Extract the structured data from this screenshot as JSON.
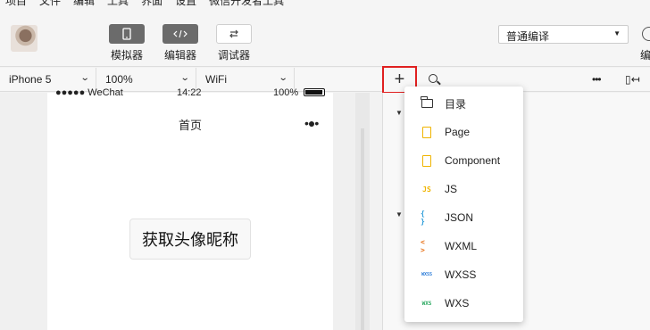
{
  "menubar": {
    "items": [
      "项目",
      "文件",
      "编辑",
      "工具",
      "界面",
      "设置",
      "微信开发者工具"
    ]
  },
  "toolbar": {
    "tools": [
      {
        "label": "模拟器",
        "icon": "phone-icon"
      },
      {
        "label": "编辑器",
        "icon": "code-icon"
      },
      {
        "label": "调试器",
        "icon": "debug-icon"
      }
    ],
    "compile_mode": "普通编译",
    "right_label": "编"
  },
  "devicebar": {
    "device": "iPhone 5",
    "zoom": "100%",
    "network": "WiFi"
  },
  "simulator": {
    "signal": "●●●●● WeChat",
    "time": "14:22",
    "battery": "100%",
    "page_title": "首页",
    "capsule": "•●•",
    "main_button": "获取头像昵称"
  },
  "dropdown": {
    "items": [
      {
        "label": "目录",
        "icon": "folder-icon",
        "color": "#333333"
      },
      {
        "label": "Page",
        "icon": "page-icon",
        "color": "#f0b400"
      },
      {
        "label": "Component",
        "icon": "component-icon",
        "color": "#f0b400"
      },
      {
        "label": "JS",
        "icon": "js-icon",
        "color": "#f0b400"
      },
      {
        "label": "JSON",
        "icon": "json-icon",
        "color": "#2a9bd8"
      },
      {
        "label": "WXML",
        "icon": "wxml-icon",
        "color": "#e8731a"
      },
      {
        "label": "WXSS",
        "icon": "wxss-icon",
        "color": "#2a7bd8"
      },
      {
        "label": "WXS",
        "icon": "wxs-icon",
        "color": "#2aa860"
      }
    ]
  },
  "icon_glyphs": {
    "js": "JS",
    "json": "{ }",
    "wxml": "< >",
    "wxss": "WXSS",
    "wxs": "WXS"
  }
}
